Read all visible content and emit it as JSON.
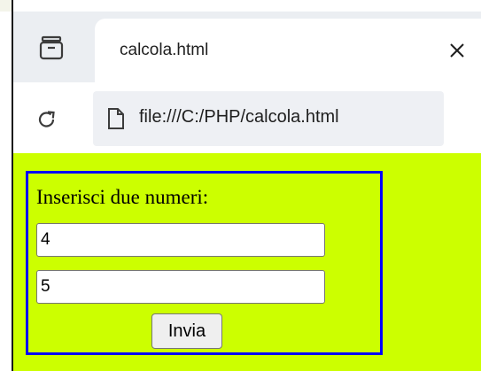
{
  "tab": {
    "title": "calcola.html"
  },
  "toolbar": {
    "url": "file:///C:/PHP/calcola.html"
  },
  "form": {
    "prompt": "Inserisci due numeri:",
    "first_value": "4",
    "second_value": "5",
    "submit_label": "Invia"
  },
  "colors": {
    "page_background": "#ccff00",
    "form_border": "#0000ff"
  },
  "icons": {
    "tab_search": "tab-search-icon",
    "close": "close-icon",
    "reload": "reload-icon",
    "page": "page-icon"
  }
}
